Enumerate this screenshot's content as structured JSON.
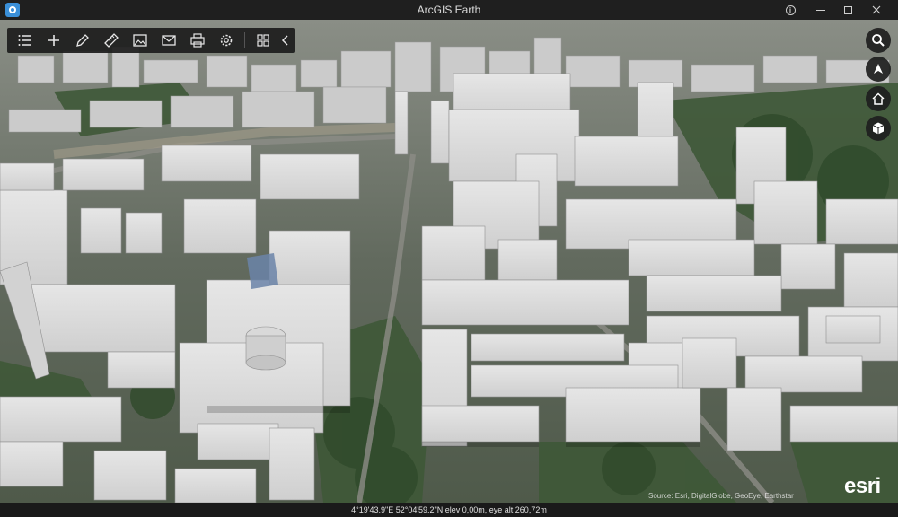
{
  "window": {
    "title": "ArcGIS Earth",
    "info_icon": "info-icon",
    "minimize_icon": "minimize-icon",
    "maximize_icon": "maximize-icon",
    "close_icon": "close-icon"
  },
  "toolbar": {
    "tools": [
      {
        "name": "layers-list-button",
        "icon": "list-icon"
      },
      {
        "name": "add-data-button",
        "icon": "plus-icon"
      },
      {
        "name": "draw-button",
        "icon": "pencil-icon"
      },
      {
        "name": "measure-button",
        "icon": "ruler-icon"
      },
      {
        "name": "basemap-button",
        "icon": "image-icon"
      },
      {
        "name": "share-button",
        "icon": "mail-icon"
      },
      {
        "name": "print-button",
        "icon": "printer-icon"
      },
      {
        "name": "settings-button",
        "icon": "gear-icon"
      },
      {
        "name": "apps-button",
        "icon": "grid-icon"
      },
      {
        "name": "collapse-toolbar-button",
        "icon": "chevron-left-icon"
      }
    ]
  },
  "navigation": [
    {
      "name": "search-button",
      "icon": "search-icon"
    },
    {
      "name": "compass-button",
      "icon": "compass-icon"
    },
    {
      "name": "home-button",
      "icon": "home-icon"
    },
    {
      "name": "view-mode-button",
      "icon": "cube-icon"
    }
  ],
  "map": {
    "attribution": "Source: Esri, DigitalGlobe, GeoEye, Earthstar",
    "logo": "esri"
  },
  "status": {
    "coordinates": "4°19'43.9\"E 52°04'59.2\"N  elev 0,00m,  eye alt 260,72m"
  },
  "colors": {
    "titlebar": "#1f1f1f",
    "toolbar": "#1c1c1c",
    "building": "#d4d4d4",
    "vegetation": "#3f5a38"
  }
}
